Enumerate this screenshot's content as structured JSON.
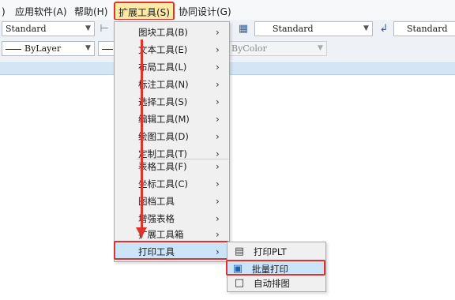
{
  "menubar": {
    "items": [
      {
        "label": ")"
      },
      {
        "label": "应用软件(A)"
      },
      {
        "label": "帮助(H)"
      },
      {
        "label": "扩展工具(S)"
      },
      {
        "label": "协同设计(G)"
      }
    ]
  },
  "toolbar1": {
    "combo1": "Standard",
    "combo2": "Standard",
    "combo3": "Standard"
  },
  "toolbar2": {
    "layer_combo": "ByLayer",
    "color_combo": "ByColor"
  },
  "dropdown": {
    "items": [
      {
        "label": "图块工具(B)"
      },
      {
        "label": "文本工具(E)"
      },
      {
        "label": "布局工具(L)"
      },
      {
        "label": "标注工具(N)"
      },
      {
        "label": "选择工具(S)"
      },
      {
        "label": "编辑工具(M)"
      },
      {
        "label": "绘图工具(D)"
      },
      {
        "label": "定制工具(T)"
      },
      {
        "label": "表格工具(F)"
      },
      {
        "label": "坐标工具(C)"
      },
      {
        "label": "图档工具"
      },
      {
        "label": "增强表格"
      },
      {
        "label": "扩展工具箱"
      },
      {
        "label": "打印工具"
      }
    ]
  },
  "submenu": {
    "items": [
      {
        "label": "打印PLT"
      },
      {
        "label": "批量打印"
      },
      {
        "label": "自动排图"
      }
    ]
  },
  "colors": {
    "highlight_border": "#e0332f",
    "highlight_fill": "#cce4f7",
    "menu_active_fill": "#fde9a6"
  }
}
